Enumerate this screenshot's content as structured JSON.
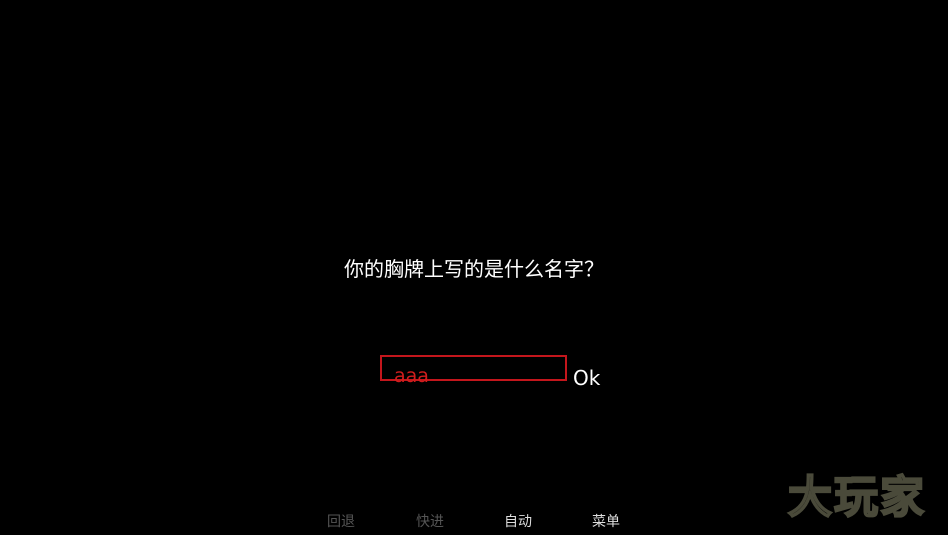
{
  "dialog": {
    "prompt": "你的胸牌上写的是什么名字？",
    "input_value": "aaa",
    "ok_label": "Ok"
  },
  "quick_menu": {
    "back_label": "回退",
    "skip_label": "快进",
    "auto_label": "自动",
    "menu_label": "菜单"
  },
  "watermark": {
    "text": "大玩家"
  },
  "colors": {
    "background": "#000000",
    "input_border": "#c4161c",
    "input_text": "#d21d1d",
    "disabled_menu": "#555555",
    "enabled_menu": "#dddddd"
  }
}
